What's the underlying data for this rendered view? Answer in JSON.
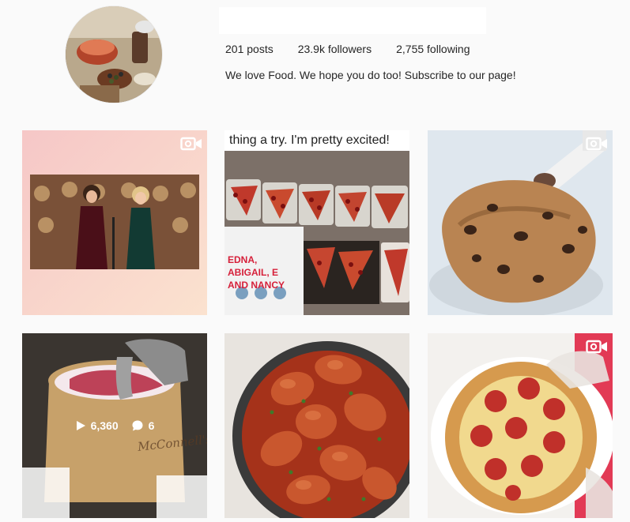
{
  "profile": {
    "stats": {
      "posts": "201 posts",
      "followers": "23.9k followers",
      "following": "2,755 following"
    },
    "bio": "We love Food. We hope you do too! Subscribe to our page!"
  },
  "posts": [
    {
      "type": "video",
      "subject": "two women on stage at award show"
    },
    {
      "type": "image",
      "caption": "thing a try. I'm pretty excited!",
      "box_text": "EDNA, ABIGAIL, E AND NANCY",
      "subject": "pizza slices in containers"
    },
    {
      "type": "video",
      "subject": "chocolate chip cookie with piping bag"
    },
    {
      "type": "video",
      "subject": "ice cream tub with scoop",
      "views": "6,360",
      "comments": "6",
      "tub_text": "McConnell's"
    },
    {
      "type": "image",
      "subject": "chicken in red sauce pot"
    },
    {
      "type": "video",
      "subject": "pepperoni stuffed crust pizza"
    }
  ],
  "icons": {
    "video": "video-camera-icon",
    "play": "play-icon",
    "comment": "comment-bubble-icon"
  }
}
